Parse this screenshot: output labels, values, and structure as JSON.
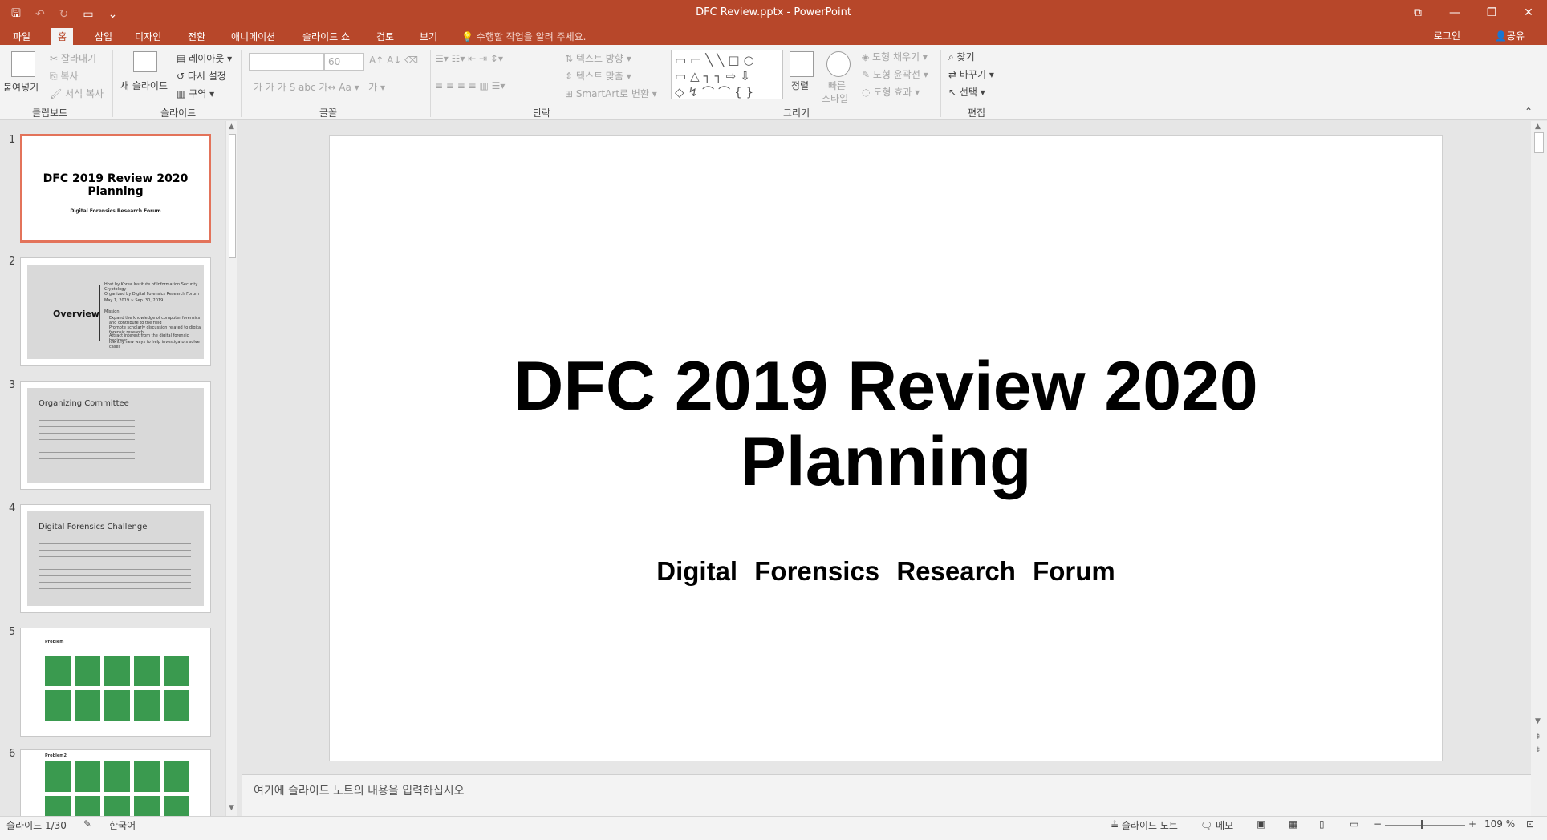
{
  "window": {
    "title": "DFC Review.pptx - PowerPoint"
  },
  "tabs": [
    {
      "label": "파일"
    },
    {
      "label": "홈"
    },
    {
      "label": "삽입"
    },
    {
      "label": "디자인"
    },
    {
      "label": "전환"
    },
    {
      "label": "애니메이션"
    },
    {
      "label": "슬라이드 쇼"
    },
    {
      "label": "검토"
    },
    {
      "label": "보기"
    }
  ],
  "tell_me": "수행할 작업을 알려 주세요.",
  "account": {
    "login": "로그인",
    "share": "공유"
  },
  "ribbon": {
    "clipboard": {
      "paste": "붙여넣기",
      "cut": "잘라내기",
      "copy": "복사",
      "format_painter": "서식 복사",
      "label": "클립보드"
    },
    "slides": {
      "new_slide": "새 슬라이드",
      "layout": "레이아웃",
      "reset": "다시 설정",
      "section": "구역",
      "label": "슬라이드"
    },
    "font": {
      "size": "60",
      "label": "글꼴"
    },
    "paragraph": {
      "text_direction": "텍스트 방향",
      "align_text": "텍스트 맞춤",
      "smartart": "SmartArt로 변환",
      "label": "단락"
    },
    "drawing": {
      "arrange": "정렬",
      "quick_styles_1": "빠른",
      "quick_styles_2": "스타일",
      "shape_fill": "도형 채우기",
      "shape_outline": "도형 윤곽선",
      "shape_effects": "도형 효과",
      "label": "그리기"
    },
    "editing": {
      "find": "찾기",
      "replace": "바꾸기",
      "select": "선택",
      "label": "편집"
    }
  },
  "thumbnails": {
    "numbers": [
      "1",
      "2",
      "3",
      "4",
      "5",
      "6"
    ],
    "slide1": {
      "title": "DFC 2019 Review 2020 Planning",
      "subtitle": "Digital   Forensics   Research   Forum"
    },
    "slide2": {
      "title": "Overview",
      "lines": [
        "Host by Korea Institute of Information Security Cryptology",
        "Organized by Digital Forensics Research Forum",
        "May 1, 2019 ~ Sep. 30, 2019",
        "Mission",
        "Expand the knowledge of computer forensics and contribute to the field",
        "Promote scholarly discussion related to digital forensic research",
        "Attract interest from the digital forensic beginner",
        "Identify new ways to help investigators solve cases"
      ]
    },
    "slide3": {
      "title": "Organizing Committee"
    },
    "slide4": {
      "title": "Digital Forensics Challenge"
    },
    "slide5": {
      "title": "Problem"
    },
    "slide6": {
      "title": "Problem2"
    }
  },
  "slide": {
    "title_line1": "DFC 2019 Review 2020",
    "title_line2": "Planning",
    "subtitle": "Digital   Forensics   Research   Forum"
  },
  "notes": {
    "placeholder": "여기에 슬라이드 노트의 내용을 입력하십시오"
  },
  "status": {
    "slide_count": "슬라이드 1/30",
    "language": "한국어",
    "notes": "슬라이드 노트",
    "comments": "메모",
    "zoom": "109 %"
  }
}
